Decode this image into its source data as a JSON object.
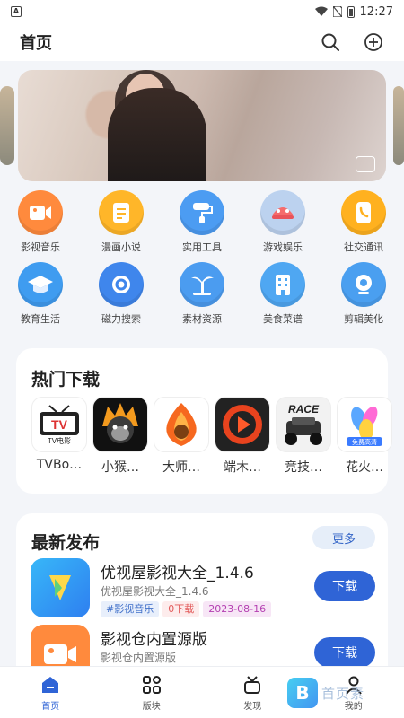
{
  "status": {
    "time": "12:27"
  },
  "header": {
    "title": "首页",
    "search_icon": "search-icon",
    "add_icon": "plus-circle-icon"
  },
  "banner": {
    "badge_icon": "gallery-icon"
  },
  "categories": [
    {
      "label": "影视音乐",
      "icon": "video-icon",
      "color": "#ff8a3d"
    },
    {
      "label": "漫画小说",
      "icon": "book-icon",
      "color": "#ffb629"
    },
    {
      "label": "实用工具",
      "icon": "paint-roller-icon",
      "color": "#4c9cf2"
    },
    {
      "label": "游戏娱乐",
      "icon": "game-icon",
      "color": "#f56c6c"
    },
    {
      "label": "社交通讯",
      "icon": "phone-icon",
      "color": "#ffb11f"
    },
    {
      "label": "教育生活",
      "icon": "graduation-cap-icon",
      "color": "#3f9cf0"
    },
    {
      "label": "磁力搜索",
      "icon": "magnet-icon",
      "color": "#3f86ec"
    },
    {
      "label": "素材资源",
      "icon": "palm-tree-icon",
      "color": "#4b9cf0"
    },
    {
      "label": "美食菜谱",
      "icon": "building-icon",
      "color": "#4fa7f2"
    },
    {
      "label": "剪辑美化",
      "icon": "camera-icon",
      "color": "#4a9ff0"
    }
  ],
  "hot": {
    "title": "热门下载",
    "items": [
      {
        "label": "TVBo…",
        "icon": "tvbox-icon",
        "logo_text": "TV",
        "logo_sub": "TV电影"
      },
      {
        "label": "小猴…",
        "icon": "monkey-icon"
      },
      {
        "label": "大师…",
        "icon": "monkey-flame-icon"
      },
      {
        "label": "端木…",
        "icon": "play-icon"
      },
      {
        "label": "竞技…",
        "icon": "race-car-icon",
        "logo_text": "RACE"
      },
      {
        "label": "花火…",
        "icon": "flower-icon",
        "logo_sub": "免费高清"
      }
    ]
  },
  "latest": {
    "title": "最新发布",
    "more_label": "更多",
    "items": [
      {
        "name": "优视屋影视大全_1.4.6",
        "subtitle": "优视屋影视大全_1.4.6",
        "tags": [
          "#影视音乐",
          "0下载",
          "2023-08-16"
        ],
        "download_label": "下载",
        "icon": "video-play-icon"
      },
      {
        "name": "影视仓内置源版",
        "subtitle": "影视仓内置源版",
        "download_label": "下载",
        "icon": "video-camera-icon"
      }
    ]
  },
  "tabs": [
    {
      "label": "首页",
      "icon": "home-icon"
    },
    {
      "label": "版块",
      "icon": "grid-icon"
    },
    {
      "label": "发现",
      "icon": "discover-icon"
    },
    {
      "label": "我的",
      "icon": "user-icon"
    }
  ],
  "watermark": {
    "logo": "B",
    "text": "首页素"
  }
}
